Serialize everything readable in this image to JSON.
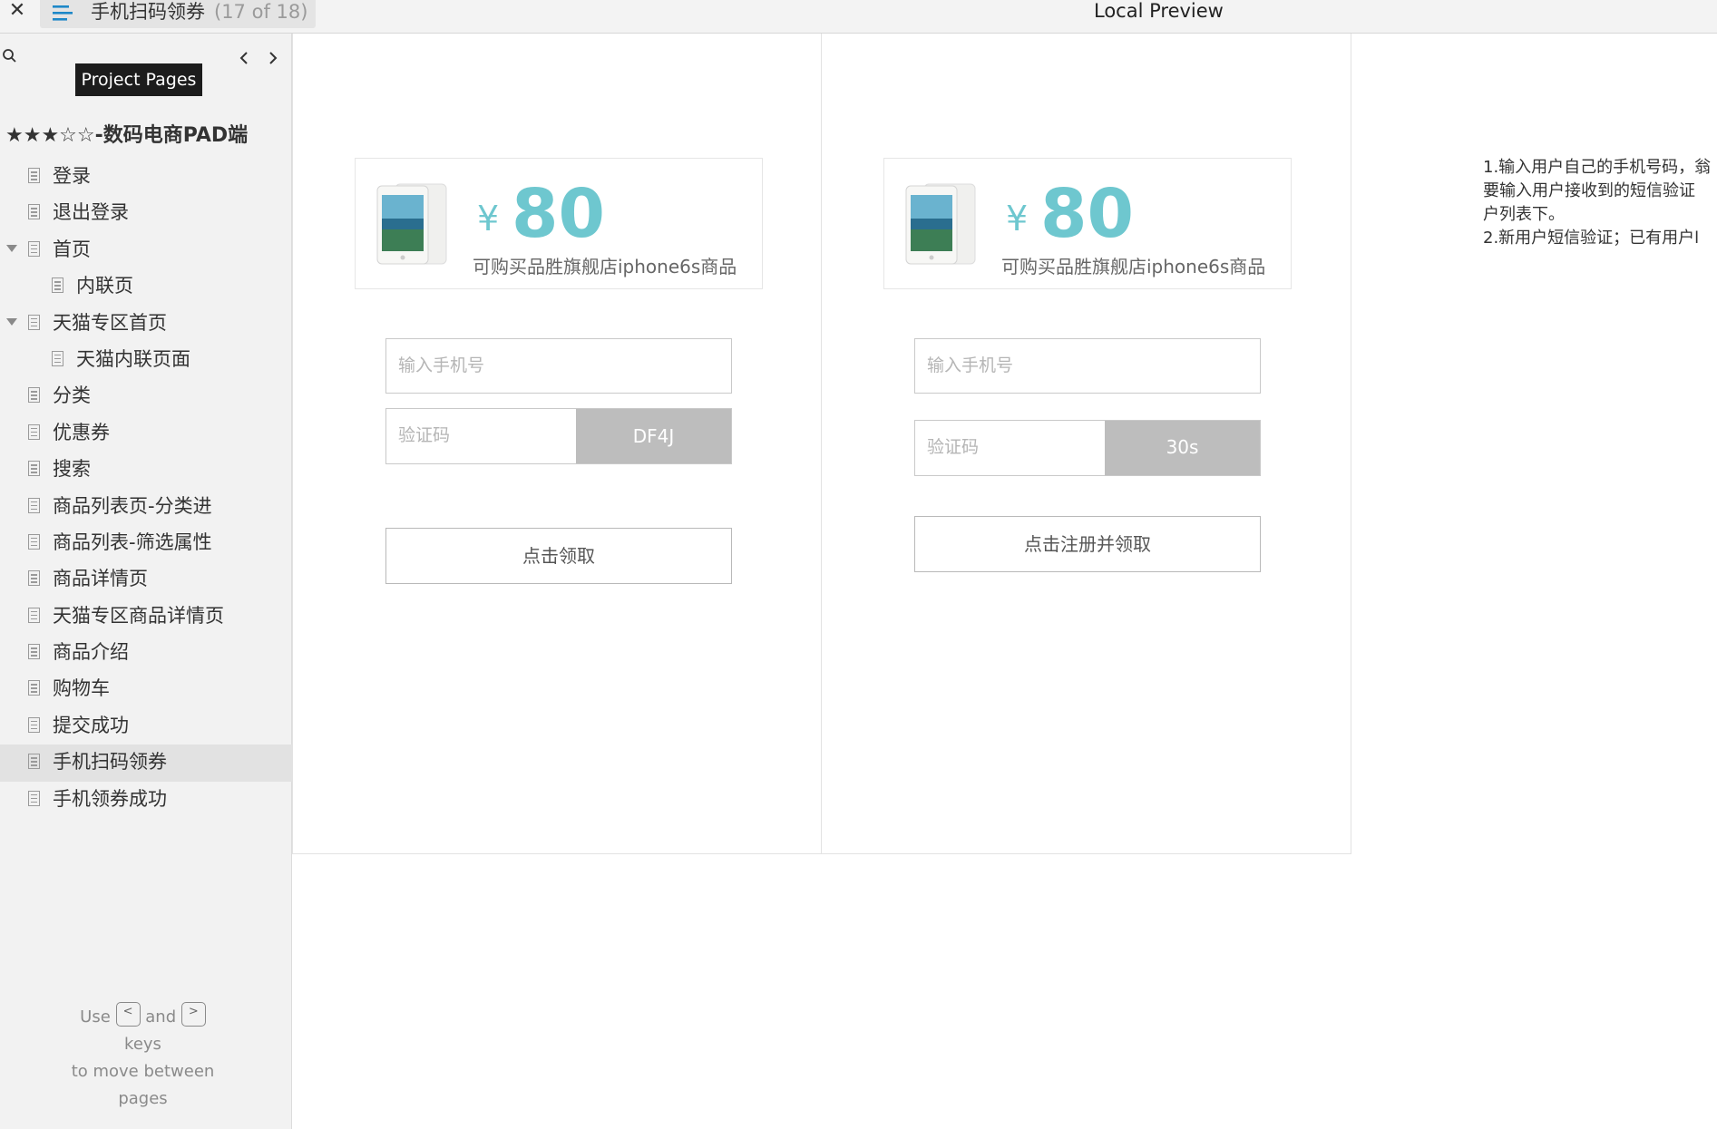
{
  "topbar": {
    "close_icon": "close-icon",
    "tab_title": "手机扫码领券",
    "tab_count": "(17 of 18)",
    "preview_title": "Local Preview"
  },
  "sidebar": {
    "tooltip": "Project Pages",
    "project_title": "★★★☆☆-数码电商PAD端",
    "items": [
      {
        "label": "登录",
        "level": 0,
        "expanded": null,
        "selected": false
      },
      {
        "label": "退出登录",
        "level": 0,
        "expanded": null,
        "selected": false
      },
      {
        "label": "首页",
        "level": 0,
        "expanded": true,
        "selected": false
      },
      {
        "label": "内联页",
        "level": 1,
        "expanded": null,
        "selected": false
      },
      {
        "label": "天猫专区首页",
        "level": 0,
        "expanded": true,
        "selected": false
      },
      {
        "label": "天猫内联页面",
        "level": 1,
        "expanded": null,
        "selected": false
      },
      {
        "label": "分类",
        "level": 0,
        "expanded": null,
        "selected": false
      },
      {
        "label": "优惠券",
        "level": 0,
        "expanded": null,
        "selected": false
      },
      {
        "label": "搜索",
        "level": 0,
        "expanded": null,
        "selected": false
      },
      {
        "label": "商品列表页-分类进",
        "level": 0,
        "expanded": null,
        "selected": false
      },
      {
        "label": "商品列表-筛选属性",
        "level": 0,
        "expanded": null,
        "selected": false
      },
      {
        "label": "商品详情页",
        "level": 0,
        "expanded": null,
        "selected": false
      },
      {
        "label": "天猫专区商品详情页",
        "level": 0,
        "expanded": null,
        "selected": false
      },
      {
        "label": "商品介绍",
        "level": 0,
        "expanded": null,
        "selected": false
      },
      {
        "label": "购物车",
        "level": 0,
        "expanded": null,
        "selected": false
      },
      {
        "label": "提交成功",
        "level": 0,
        "expanded": null,
        "selected": false
      },
      {
        "label": "手机扫码领券",
        "level": 0,
        "expanded": null,
        "selected": true
      },
      {
        "label": "手机领券成功",
        "level": 0,
        "expanded": null,
        "selected": false
      }
    ],
    "help": {
      "use": "Use",
      "key_prev": "<",
      "and": "and",
      "key_next": ">",
      "keys": "keys",
      "line2": "to move between",
      "line3": "pages"
    }
  },
  "panels": [
    {
      "yen": "¥",
      "amount": "80",
      "coupon_desc": "可购买品胜旗舰店iphone6s商品",
      "phone_placeholder": "输入手机号",
      "code_placeholder": "验证码",
      "code_button": "DF4J",
      "cta": "点击领取"
    },
    {
      "yen": "¥",
      "amount": "80",
      "coupon_desc": "可购买品胜旗舰店iphone6s商品",
      "phone_placeholder": "输入手机号",
      "code_placeholder": "验证码",
      "code_button": "30s",
      "cta": "点击注册并领取"
    }
  ],
  "notes": {
    "line1": "1.输入用户自己的手机号码，翁",
    "line2": "要输入用户接收到的短信验证",
    "line3": "户列表下。",
    "line4": "2.新用户短信验证；已有用户l"
  },
  "colors": {
    "accent": "#6ec7cf",
    "menu_icon": "#1e88c8",
    "code_button_bg": "#bdbdbd"
  }
}
